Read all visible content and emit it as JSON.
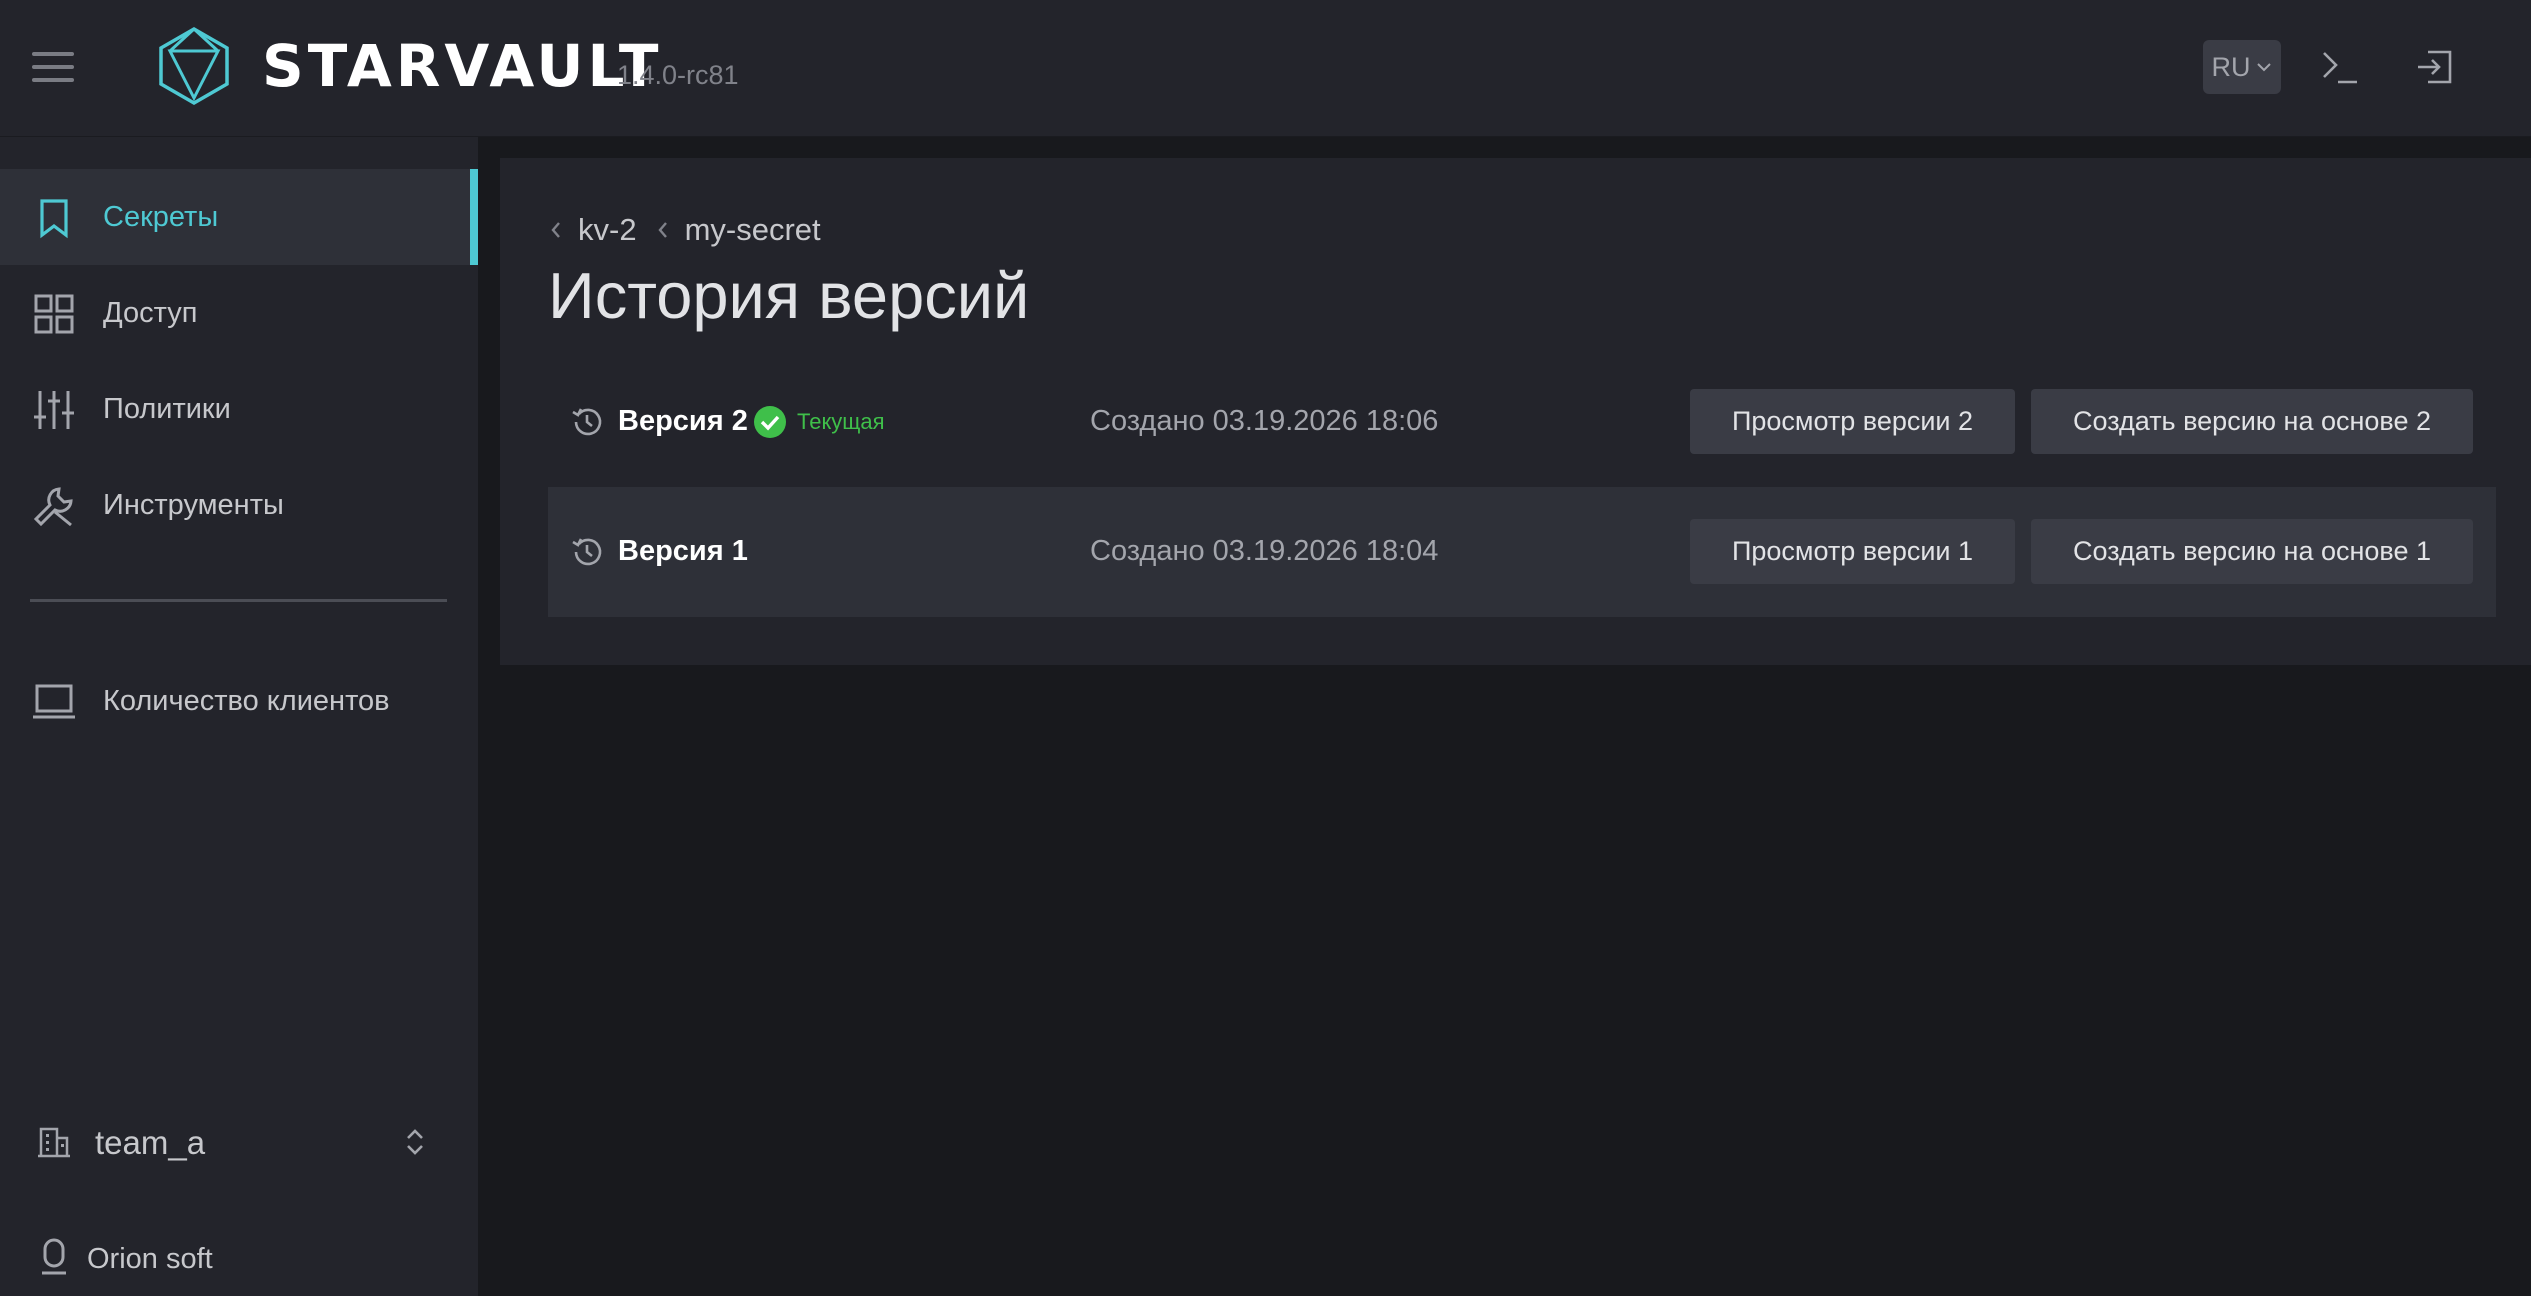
{
  "header": {
    "logo_text": "STARVAULT",
    "version": "1.4.0-rc81",
    "language": "RU"
  },
  "sidebar": {
    "items": [
      {
        "label": "Секреты",
        "icon": "bookmark-icon",
        "active": true
      },
      {
        "label": "Доступ",
        "icon": "grid-icon"
      },
      {
        "label": "Политики",
        "icon": "sliders-icon"
      },
      {
        "label": "Инструменты",
        "icon": "wrench-icon"
      },
      {
        "label": "Количество клиентов",
        "icon": "laptop-icon"
      }
    ],
    "team": "team_a",
    "org": "Orion soft"
  },
  "breadcrumb": [
    "kv-2",
    "my-secret"
  ],
  "page_title": "История версий",
  "versions": [
    {
      "label": "Версия 2",
      "badge": "Текущая",
      "created": "Создано 03.19.2026 18:06",
      "view_label": "Просмотр версии 2",
      "create_label": "Создать версию на основе 2"
    },
    {
      "label": "Версия 1",
      "created": "Создано 03.19.2026 18:04",
      "view_label": "Просмотр версии 1",
      "create_label": "Создать версию на основе 1"
    }
  ],
  "colors": {
    "accent": "#4ec9d3",
    "success": "#3fbf4a",
    "background": "#18191d",
    "surface": "#23242b"
  }
}
